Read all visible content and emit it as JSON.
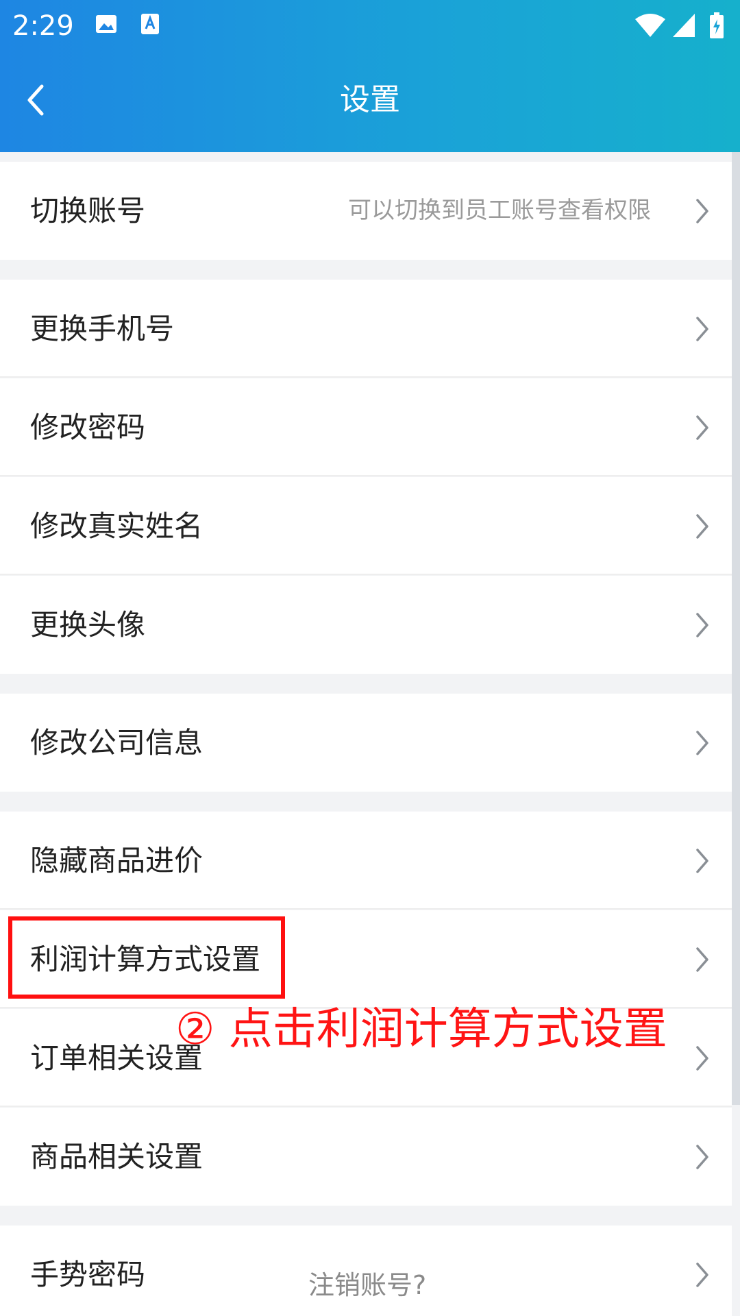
{
  "status_bar": {
    "time": "2:29",
    "icons": [
      "image-icon",
      "text-a-icon",
      "wifi-icon",
      "cellular-signal-icon",
      "battery-charging-icon"
    ]
  },
  "header": {
    "title": "设置",
    "back_icon": "chevron-left-icon"
  },
  "groups": [
    {
      "items": [
        {
          "label": "切换账号",
          "hint": "可以切换到员工账号查看权限"
        }
      ]
    },
    {
      "items": [
        {
          "label": "更换手机号"
        },
        {
          "label": "修改密码"
        },
        {
          "label": "修改真实姓名"
        },
        {
          "label": "更换头像"
        }
      ]
    },
    {
      "items": [
        {
          "label": "修改公司信息"
        }
      ]
    },
    {
      "items": [
        {
          "label": "隐藏商品进价"
        },
        {
          "label": "利润计算方式设置"
        },
        {
          "label": "订单相关设置"
        },
        {
          "label": "商品相关设置"
        }
      ]
    },
    {
      "items": [
        {
          "label": "手势密码"
        }
      ]
    }
  ],
  "footer": {
    "link_label": "注销账号?"
  },
  "annotation": {
    "text": "② 点击利润计算方式设置",
    "color": "#ff1414"
  },
  "colors": {
    "header_gradient_start": "#1e86e3",
    "header_gradient_end": "#16b0cc",
    "highlight": "#ff1010"
  }
}
